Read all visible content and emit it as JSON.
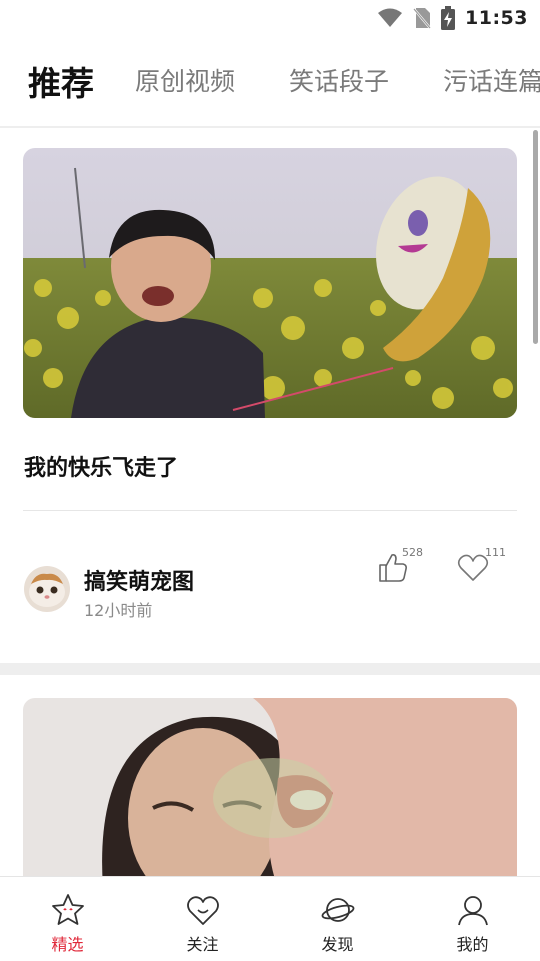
{
  "status_bar": {
    "time": "11:53"
  },
  "tabs": [
    {
      "label": "推荐",
      "active": true
    },
    {
      "label": "原创视频"
    },
    {
      "label": "笑话段子"
    },
    {
      "label": "污话连篇"
    }
  ],
  "feed": {
    "cards": [
      {
        "title": "我的快乐飞走了",
        "author": "搞笑萌宠图",
        "time": "12小时前",
        "like_count": "528",
        "fav_count": "111"
      }
    ]
  },
  "bottom_nav": [
    {
      "label": "精选",
      "icon": "star-icon",
      "active": true
    },
    {
      "label": "关注",
      "icon": "heart-icon"
    },
    {
      "label": "发现",
      "icon": "planet-icon"
    },
    {
      "label": "我的",
      "icon": "user-icon"
    }
  ],
  "colors": {
    "accent": "#e0283a",
    "text": "#111111",
    "muted": "#8a8a8a"
  }
}
